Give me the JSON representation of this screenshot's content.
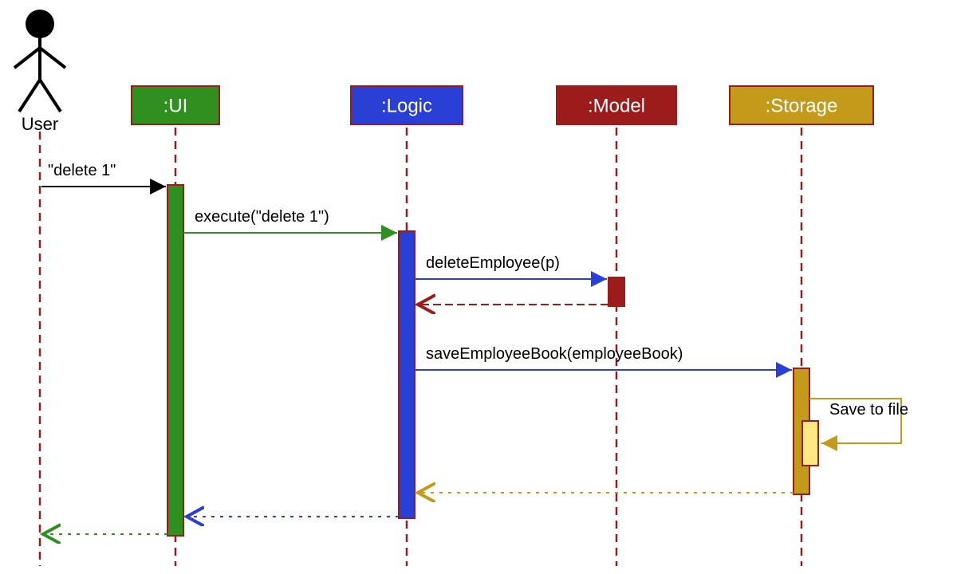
{
  "actor": {
    "label": "User"
  },
  "participants": {
    "ui": {
      "label": ":UI",
      "fill": "#2f8f1f",
      "stroke": "#9c1b1b"
    },
    "logic": {
      "label": ":Logic",
      "fill": "#2a3fd6",
      "stroke": "#9c1b1b"
    },
    "model": {
      "label": ":Model",
      "fill": "#9c1b1b",
      "stroke": "#9c1b1b"
    },
    "storage": {
      "label": ":Storage",
      "fill": "#c49a1a",
      "stroke": "#9c1b1b"
    }
  },
  "messages": {
    "m1": "\"delete 1\"",
    "m2": "execute(\"delete 1\")",
    "m3": "deleteEmployee(p)",
    "m4": "saveEmployeeBook(employeeBook)",
    "m5": "Save to file"
  }
}
